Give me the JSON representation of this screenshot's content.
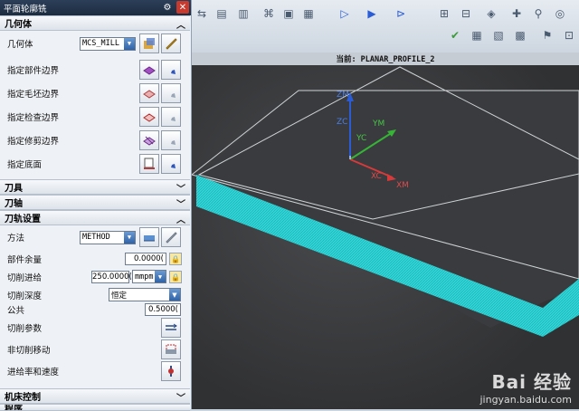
{
  "dialog": {
    "title": "平面轮廓铣",
    "sections": {
      "geometry": "几何体",
      "tool": "刀具",
      "axis": "刀轴",
      "path_settings": "刀轨设置",
      "machine_control": "机床控制",
      "next": "程序"
    },
    "geometry": {
      "geometry_label": "几何体",
      "geometry_value": "MCS_MILL",
      "part_boundary": "指定部件边界",
      "blank_boundary": "指定毛坯边界",
      "check_boundary": "指定检查边界",
      "trim_boundary": "指定修剪边界",
      "floor": "指定底面"
    },
    "path": {
      "method_label": "方法",
      "method_value": "METHOD",
      "stock_label": "部件余量",
      "stock_value": "0.0000(",
      "feed_label": "切削进给",
      "feed_value": "250.0000(",
      "feed_unit": "mmpm",
      "depth_label": "切削深度",
      "depth_value": "恒定",
      "common_label": "公共",
      "common_value": "0.5000(",
      "cut_params": "切削参数",
      "non_cut": "非切削移动",
      "feeds_speeds": "进给率和速度"
    }
  },
  "viewport": {
    "title": "当前: PLANAR_PROFILE_2",
    "axes": {
      "zm": "ZM",
      "zc": "ZC",
      "ym": "YM",
      "yc": "YC",
      "xc": "XC",
      "xm": "XM"
    },
    "colors": {
      "part": "#2fd6d6",
      "z": "#2a5cd6",
      "y": "#36b436",
      "x": "#d63a3a"
    }
  },
  "watermark": {
    "brand": "Bai 经验",
    "url": "jingyan.baidu.com"
  }
}
